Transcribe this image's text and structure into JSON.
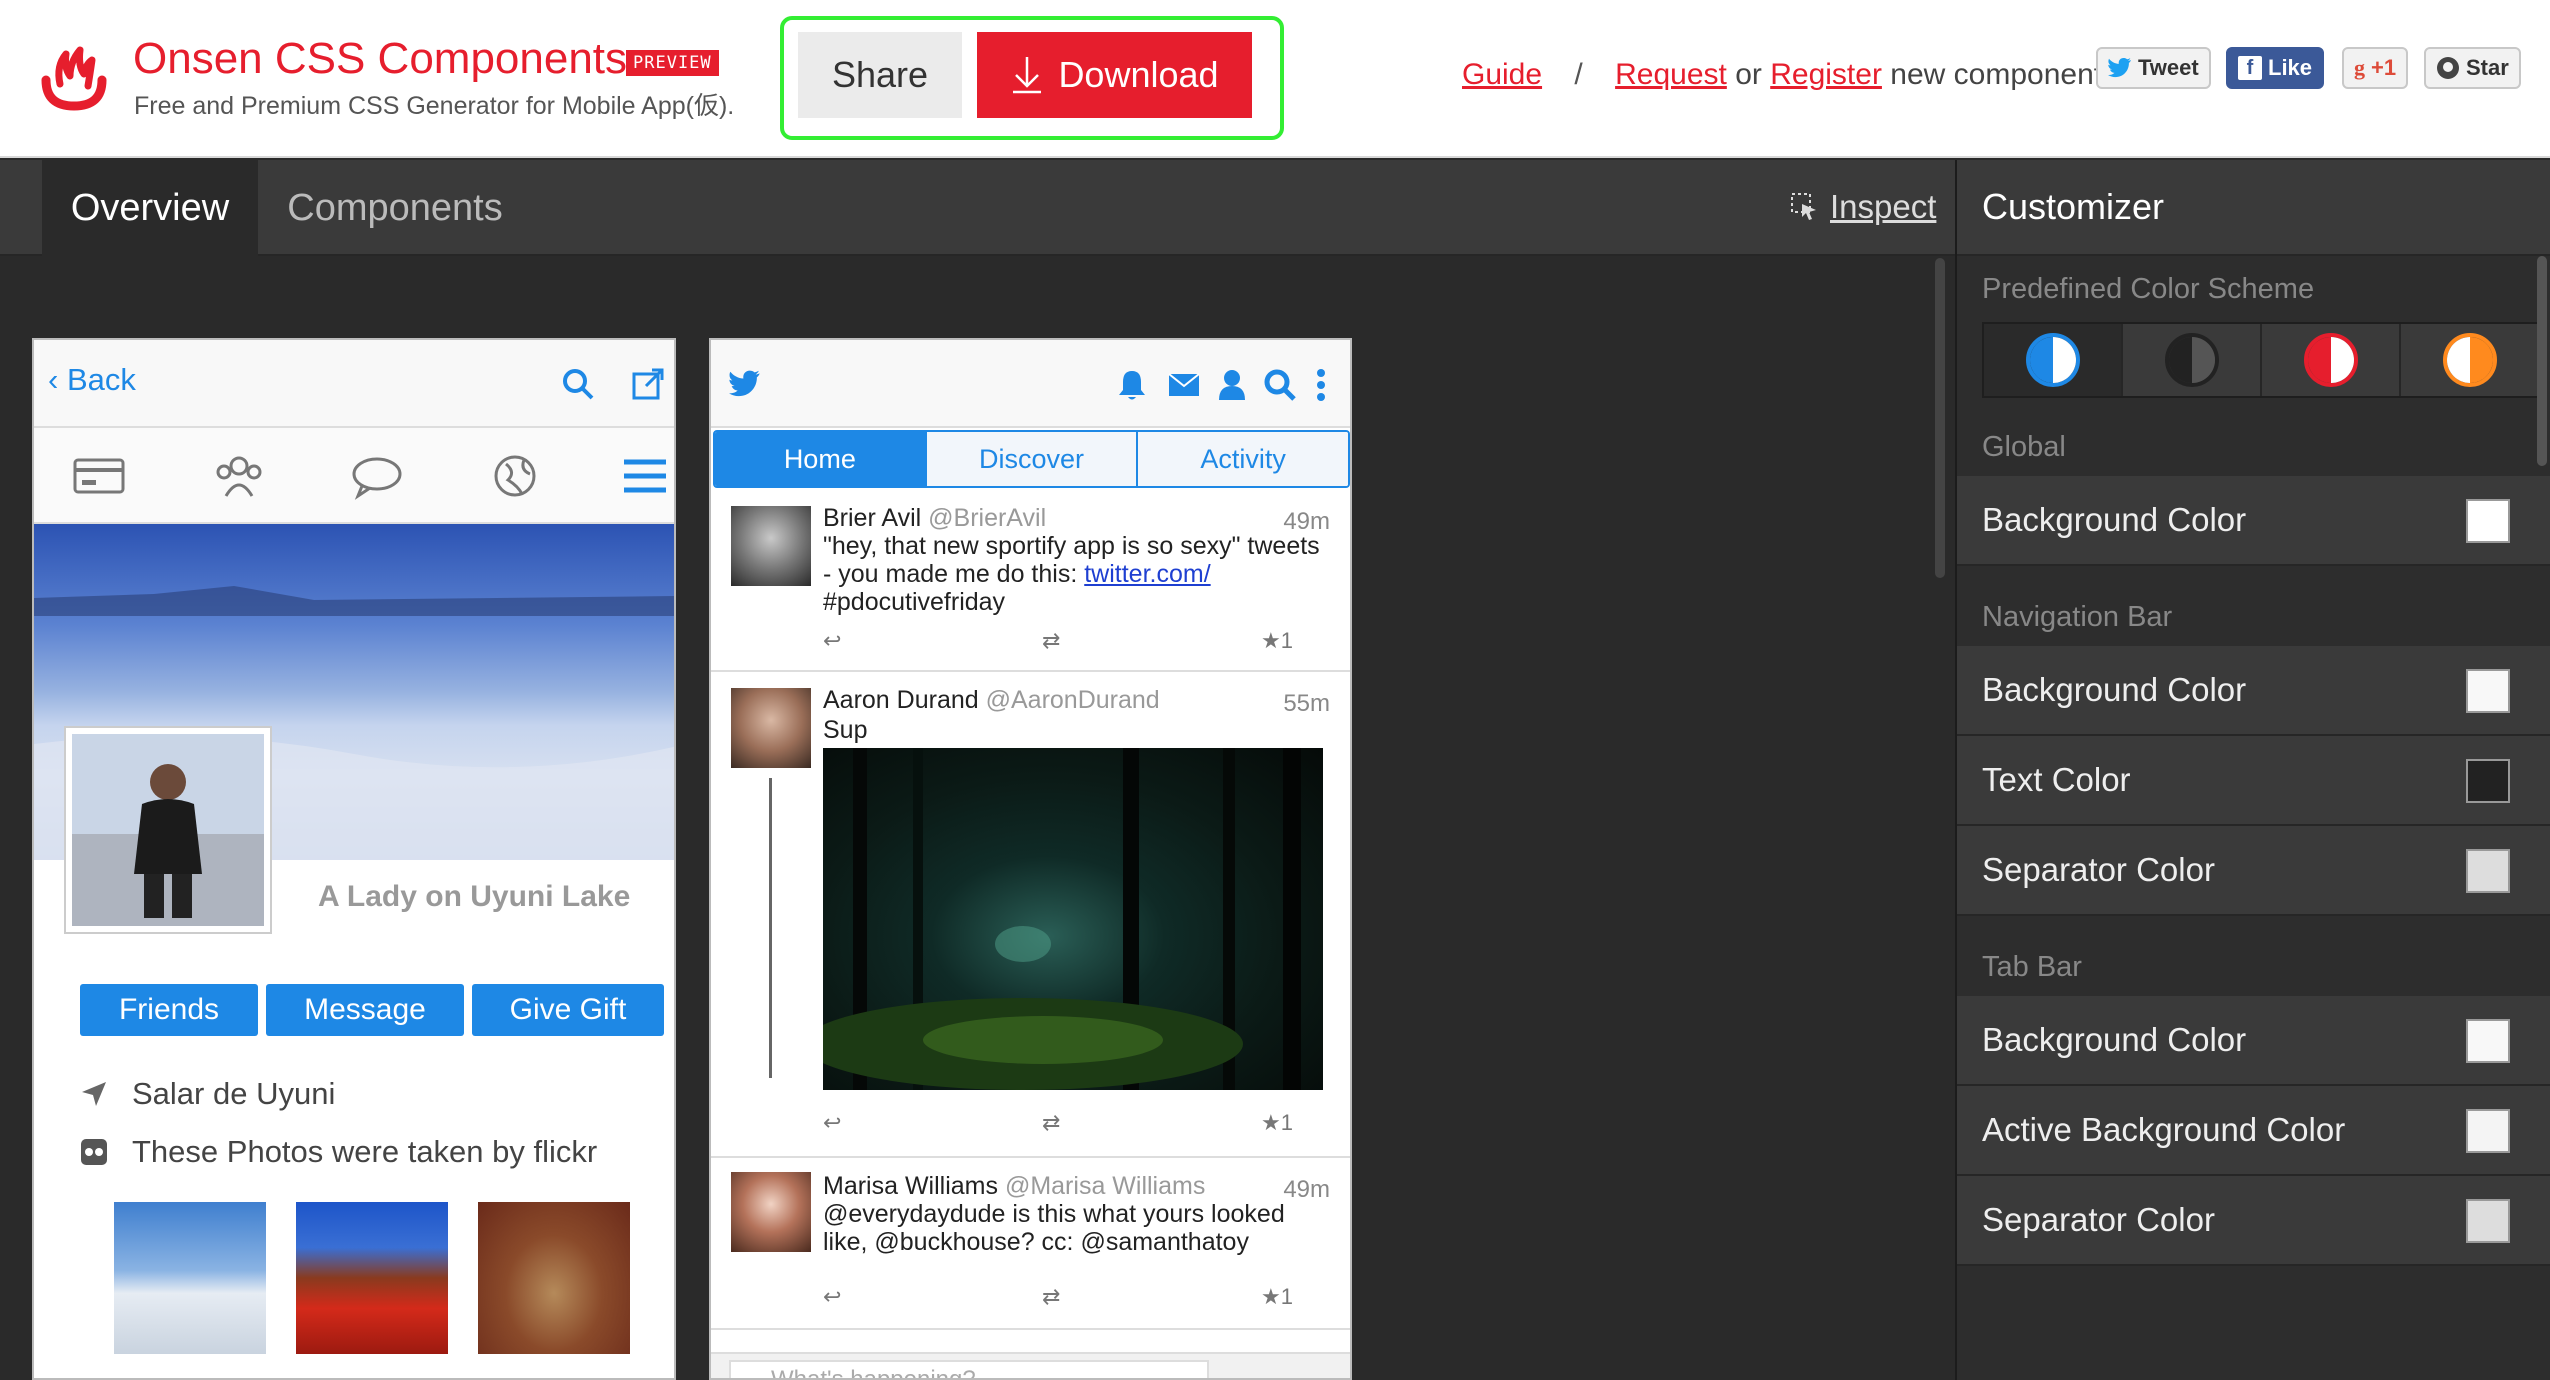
{
  "header": {
    "brand_title": "Onsen CSS Components",
    "preview_badge": "PREVIEW",
    "brand_subtitle": "Free and Premium CSS Generator for Mobile App(仮).",
    "share_label": "Share",
    "download_label": "Download",
    "links": {
      "guide": "Guide",
      "slash": "/",
      "request": "Request",
      "or": "or",
      "register": "Register",
      "suffix": "new components"
    },
    "social": {
      "tweet": "Tweet",
      "like": "Like",
      "gplus": "+1",
      "star": "Star"
    },
    "accent_color": "#e61e2d",
    "highlight_color": "#33ee33"
  },
  "subnav": {
    "tabs": [
      {
        "label": "Overview",
        "active": true
      },
      {
        "label": "Components",
        "active": false
      }
    ],
    "inspect_label": "Inspect"
  },
  "sidebar": {
    "title": "Customizer",
    "predefined_label": "Predefined Color Scheme",
    "schemes": [
      {
        "name": "blue",
        "color": "#1e88e5",
        "active": true
      },
      {
        "name": "dark",
        "color": "#333333",
        "active": false
      },
      {
        "name": "red",
        "color": "#e61e2d",
        "active": false
      },
      {
        "name": "orange",
        "color": "#ff8a1e",
        "active": false
      }
    ],
    "sections": [
      {
        "title": "Global",
        "rows": [
          {
            "label": "Background Color",
            "swatch": "#ffffff"
          }
        ]
      },
      {
        "title": "Navigation Bar",
        "rows": [
          {
            "label": "Background Color",
            "swatch": "#f8f8f8"
          },
          {
            "label": "Text Color",
            "swatch": "#222222"
          },
          {
            "label": "Separator Color",
            "swatch": "#dddddd"
          }
        ]
      },
      {
        "title": "Tab Bar",
        "rows": [
          {
            "label": "Background Color",
            "swatch": "#f8f8f8"
          },
          {
            "label": "Active Background Color",
            "swatch": "#f4f4f4"
          },
          {
            "label": "Separator Color",
            "swatch": "#dddddd"
          }
        ]
      }
    ]
  },
  "phone1": {
    "back_label": "Back",
    "profile_name": "A Lady on Uyuni Lake",
    "buttons": [
      "Friends",
      "Message",
      "Give Gift"
    ],
    "location": "Salar de Uyuni",
    "photos_note": "These Photos were taken by flickr"
  },
  "phone2": {
    "tabs": [
      "Home",
      "Discover",
      "Activity"
    ],
    "tweets": [
      {
        "name": "Brier Avil",
        "handle": "@BrierAvil",
        "time": "49m",
        "text_pre": "\"hey, that new sportify app is so sexy\" tweets - you made me do this: ",
        "link": "twitter.com/",
        "text_post": "#pdocutivefriday",
        "stars": "1"
      },
      {
        "name": "Aaron Durand",
        "handle": "@AaronDurand",
        "time": "55m",
        "text": "Sup",
        "stars": "1"
      },
      {
        "name": "Marisa Williams",
        "handle": "@Marisa Williams",
        "time": "49m",
        "text": "@everydaydude is this what yours looked like, @buckhouse? cc: @samanthatoy",
        "stars": "1"
      }
    ],
    "compose_placeholder": "What's happening?"
  }
}
